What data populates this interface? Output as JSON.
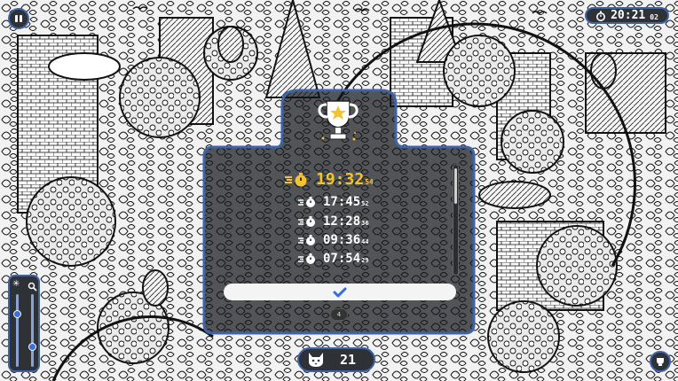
{
  "header": {
    "timer": {
      "main": "20:21",
      "fraction": "02"
    }
  },
  "results": {
    "best": {
      "main": "19:32",
      "fraction": "54"
    },
    "runs": [
      {
        "main": "17:45",
        "fraction": "52"
      },
      {
        "main": "12:28",
        "fraction": "36"
      },
      {
        "main": "09:36",
        "fraction": "44"
      },
      {
        "main": "07:54",
        "fraction": "29"
      }
    ],
    "page_indicator": "4"
  },
  "footer": {
    "found_count": "21"
  },
  "colors": {
    "accent_blue": "#3e63a8",
    "gold": "#f3c230",
    "panel": "#1e2024",
    "check_blue": "#2f6fe0"
  },
  "icons": {
    "pause": "pause-icon",
    "timer": "stopwatch-icon",
    "trophy": "trophy-icon",
    "check": "checkmark-icon",
    "cat": "cat-icon",
    "zoom": "magnifier-icon",
    "brightness": "sun-icon",
    "hint": "hint-icon"
  }
}
